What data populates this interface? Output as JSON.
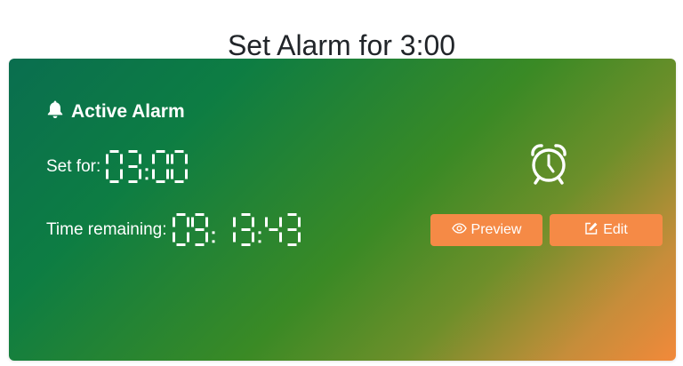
{
  "page": {
    "title": "Set Alarm for 3:00"
  },
  "card": {
    "title": "Active Alarm",
    "header_icon": "bell-icon",
    "set_for_label": "Set for:",
    "set_for_value": "03:00",
    "remaining_label": "Time remaining:",
    "remaining_value": "09:13:43",
    "status_icon": "alarm-clock-icon"
  },
  "actions": {
    "preview_label": "Preview",
    "preview_icon": "eye-icon",
    "edit_label": "Edit",
    "edit_icon": "edit-icon"
  },
  "colors": {
    "gradient_start": "#0a6e4f",
    "gradient_mid": "#3a8a25",
    "gradient_end": "#f2893a",
    "button": "#f58a46",
    "text": "#ffffff"
  }
}
